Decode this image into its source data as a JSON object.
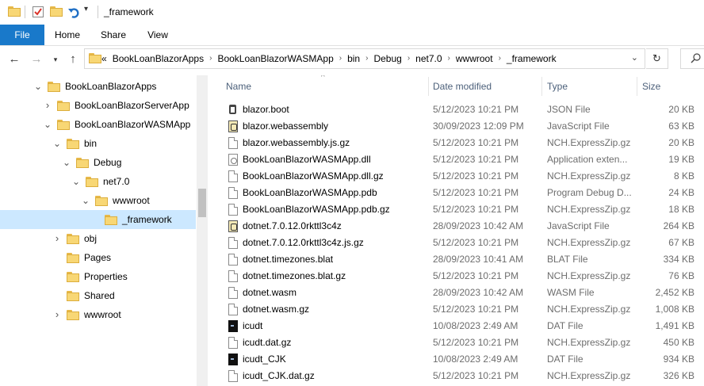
{
  "titlebar": {
    "title": "_framework"
  },
  "ribbon": {
    "tabs": [
      "File",
      "Home",
      "Share",
      "View"
    ]
  },
  "address": {
    "overflow": "«",
    "crumbs": [
      "BookLoanBlazorApps",
      "BookLoanBlazorWASMApp",
      "bin",
      "Debug",
      "net7.0",
      "wwwroot",
      "_framework"
    ]
  },
  "tree": [
    {
      "label": "BookLoanBlazorApps",
      "indent": 0,
      "chevron": "expanded"
    },
    {
      "label": "BookLoanBlazorServerApp",
      "indent": 1,
      "chevron": "collapsed"
    },
    {
      "label": "BookLoanBlazorWASMApp",
      "indent": 1,
      "chevron": "expanded"
    },
    {
      "label": "bin",
      "indent": 2,
      "chevron": "expanded"
    },
    {
      "label": "Debug",
      "indent": 3,
      "chevron": "expanded"
    },
    {
      "label": "net7.0",
      "indent": 4,
      "chevron": "expanded"
    },
    {
      "label": "wwwroot",
      "indent": 5,
      "chevron": "expanded"
    },
    {
      "label": "_framework",
      "indent": 6,
      "chevron": "none",
      "selected": true
    },
    {
      "label": "obj",
      "indent": 2,
      "chevron": "collapsed"
    },
    {
      "label": "Pages",
      "indent": 2,
      "chevron": "none"
    },
    {
      "label": "Properties",
      "indent": 2,
      "chevron": "none"
    },
    {
      "label": "Shared",
      "indent": 2,
      "chevron": "none"
    },
    {
      "label": "wwwroot",
      "indent": 2,
      "chevron": "collapsed"
    }
  ],
  "columns": {
    "name": "Name",
    "date": "Date modified",
    "type": "Type",
    "size": "Size"
  },
  "files": [
    {
      "name": "blazor.boot",
      "date": "5/12/2023 10:21 PM",
      "type": "JSON File",
      "size": "20 KB",
      "icon": "json"
    },
    {
      "name": "blazor.webassembly",
      "date": "30/09/2023 12:09 PM",
      "type": "JavaScript File",
      "size": "63 KB",
      "icon": "js"
    },
    {
      "name": "blazor.webassembly.js.gz",
      "date": "5/12/2023 10:21 PM",
      "type": "NCH.ExpressZip.gz",
      "size": "20 KB",
      "icon": "doc"
    },
    {
      "name": "BookLoanBlazorWASMApp.dll",
      "date": "5/12/2023 10:21 PM",
      "type": "Application exten...",
      "size": "19 KB",
      "icon": "dll"
    },
    {
      "name": "BookLoanBlazorWASMApp.dll.gz",
      "date": "5/12/2023 10:21 PM",
      "type": "NCH.ExpressZip.gz",
      "size": "8 KB",
      "icon": "doc"
    },
    {
      "name": "BookLoanBlazorWASMApp.pdb",
      "date": "5/12/2023 10:21 PM",
      "type": "Program Debug D...",
      "size": "24 KB",
      "icon": "doc"
    },
    {
      "name": "BookLoanBlazorWASMApp.pdb.gz",
      "date": "5/12/2023 10:21 PM",
      "type": "NCH.ExpressZip.gz",
      "size": "18 KB",
      "icon": "doc"
    },
    {
      "name": "dotnet.7.0.12.0rkttl3c4z",
      "date": "28/09/2023 10:42 AM",
      "type": "JavaScript File",
      "size": "264 KB",
      "icon": "js"
    },
    {
      "name": "dotnet.7.0.12.0rkttl3c4z.js.gz",
      "date": "5/12/2023 10:21 PM",
      "type": "NCH.ExpressZip.gz",
      "size": "67 KB",
      "icon": "doc"
    },
    {
      "name": "dotnet.timezones.blat",
      "date": "28/09/2023 10:41 AM",
      "type": "BLAT File",
      "size": "334 KB",
      "icon": "doc"
    },
    {
      "name": "dotnet.timezones.blat.gz",
      "date": "5/12/2023 10:21 PM",
      "type": "NCH.ExpressZip.gz",
      "size": "76 KB",
      "icon": "doc"
    },
    {
      "name": "dotnet.wasm",
      "date": "28/09/2023 10:42 AM",
      "type": "WASM File",
      "size": "2,452 KB",
      "icon": "doc"
    },
    {
      "name": "dotnet.wasm.gz",
      "date": "5/12/2023 10:21 PM",
      "type": "NCH.ExpressZip.gz",
      "size": "1,008 KB",
      "icon": "doc"
    },
    {
      "name": "icudt",
      "date": "10/08/2023 2:49 AM",
      "type": "DAT File",
      "size": "1,491 KB",
      "icon": "dat"
    },
    {
      "name": "icudt.dat.gz",
      "date": "5/12/2023 10:21 PM",
      "type": "NCH.ExpressZip.gz",
      "size": "450 KB",
      "icon": "doc"
    },
    {
      "name": "icudt_CJK",
      "date": "10/08/2023 2:49 AM",
      "type": "DAT File",
      "size": "934 KB",
      "icon": "dat"
    },
    {
      "name": "icudt_CJK.dat.gz",
      "date": "5/12/2023 10:21 PM",
      "type": "NCH.ExpressZip.gz",
      "size": "326 KB",
      "icon": "doc"
    }
  ]
}
